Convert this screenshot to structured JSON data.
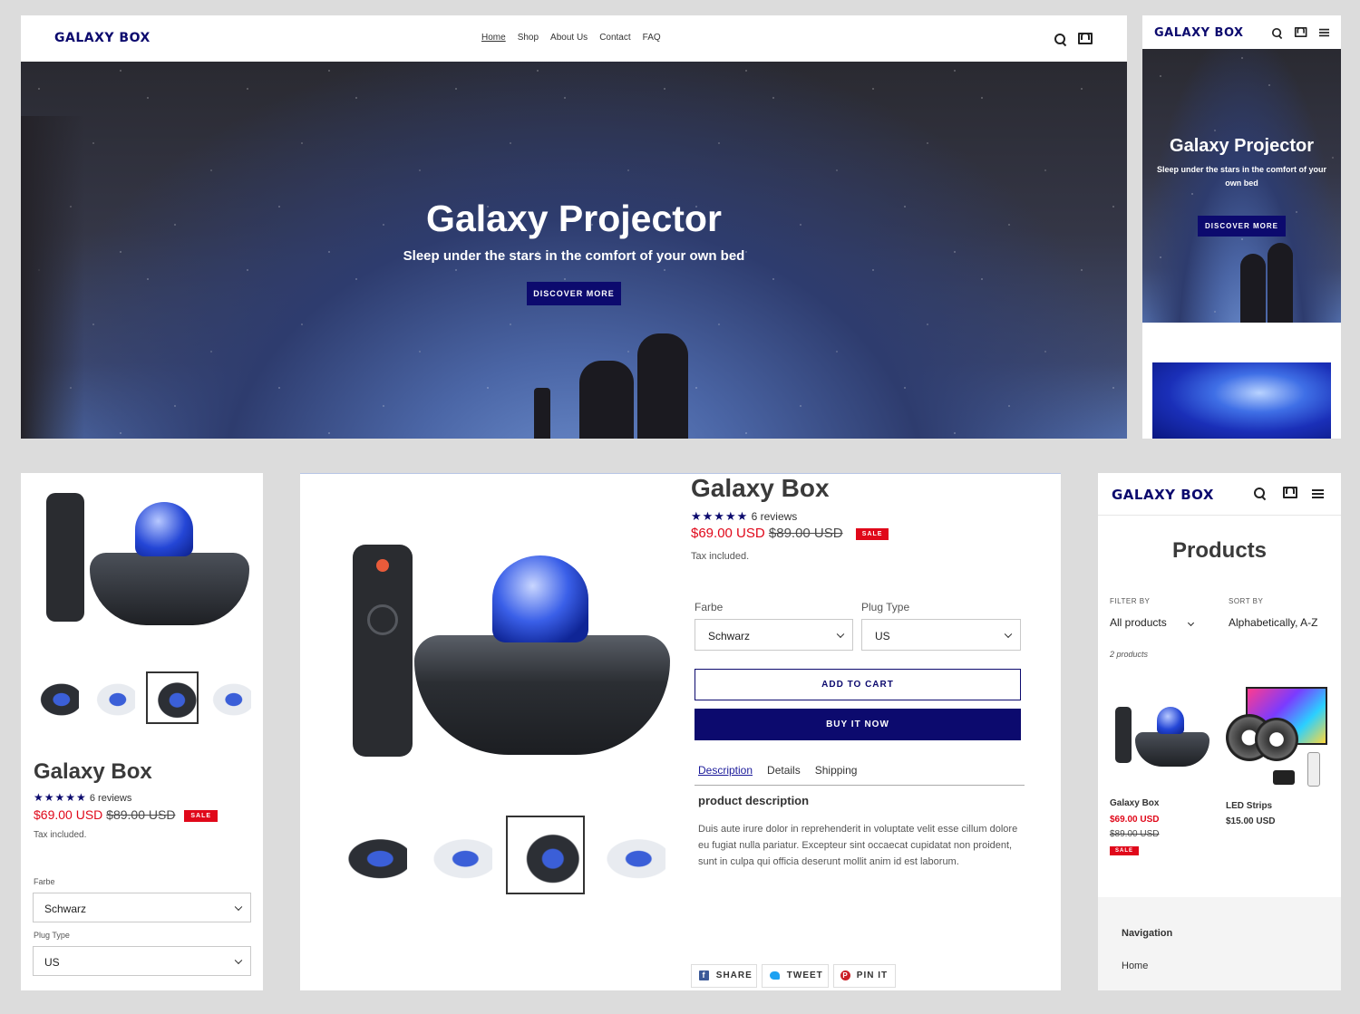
{
  "brand": {
    "logo_text_a": "GALAXY B",
    "logo_text_o": "O",
    "logo_text_b": "X"
  },
  "desktop_home": {
    "nav": [
      "Home",
      "Shop",
      "About Us",
      "Contact",
      "FAQ"
    ],
    "hero_title": "Galaxy Projector",
    "hero_subtitle": "Sleep under the stars in the comfort of your own bed",
    "hero_button": "DISCOVER MORE"
  },
  "mobile_home": {
    "hero_title": "Galaxy Projector",
    "hero_subtitle": "Sleep under the stars in the comfort of your own bed",
    "hero_button": "DISCOVER MORE"
  },
  "product": {
    "title": "Galaxy Box",
    "stars": "★★★★★",
    "reviews": "6 reviews",
    "price": "$69.00 USD",
    "compare_price": "$89.00 USD",
    "sale_badge": "SALE",
    "tax_note": "Tax included.",
    "option1_label": "Farbe",
    "option1_value": "Schwarz",
    "option2_label": "Plug Type",
    "option2_value": "US",
    "add_to_cart": "ADD TO CART",
    "buy_now": "BUY IT NOW",
    "tabs": [
      "Description",
      "Details",
      "Shipping"
    ],
    "description_heading": "product description",
    "description_body": "Duis aute irure dolor in reprehenderit in voluptate velit esse cillum dolore eu fugiat nulla pariatur. Excepteur sint occaecat cupidatat non proident, sunt in culpa qui officia deserunt mollit anim id est laborum.",
    "share": "SHARE",
    "tweet": "TWEET",
    "pin": "PIN IT"
  },
  "collection": {
    "title": "Products",
    "filter_label": "FILTER BY",
    "filter_value": "All products",
    "sort_label": "SORT BY",
    "sort_value": "Alphabetically, A-Z",
    "count": "2 products",
    "items": [
      {
        "name": "Galaxy Box",
        "price": "$69.00 USD",
        "compare": "$89.00 USD",
        "badge": "SALE"
      },
      {
        "name": "LED Strips",
        "price": "$15.00 USD"
      }
    ],
    "footer_heading": "Navigation",
    "footer_link": "Home"
  },
  "colors": {
    "accent": "#0c0a6e",
    "sale": "#e0081a",
    "backdrop": "#dcdcdc"
  },
  "icons": [
    "search-icon",
    "cart-icon",
    "menu-icon",
    "facebook-icon",
    "twitter-icon",
    "pinterest-icon"
  ]
}
